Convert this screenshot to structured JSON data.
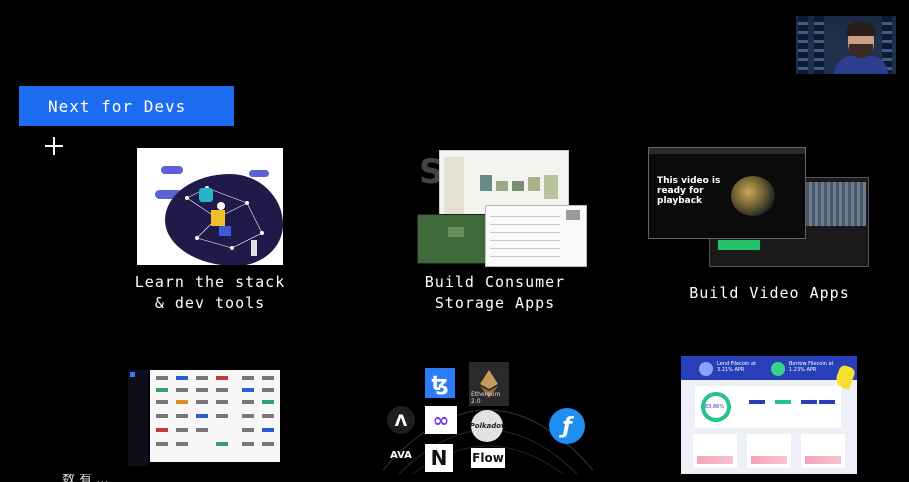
{
  "slide": {
    "title": "Next for Devs"
  },
  "cards": {
    "learn": {
      "caption": "Learn the stack\n& dev tools"
    },
    "storage": {
      "caption": "Build Consumer\nStorage Apps"
    },
    "video": {
      "caption": "Build Video Apps",
      "screen_text": "This video is\nready for\nplayback"
    }
  },
  "chains": {
    "ethereum_label": "Ethereum 2.0",
    "polkadot_label": "Polkadot",
    "flow_label": "Flow",
    "avax_label": "AVA"
  },
  "dashboard": {
    "stat1": "Lend Filecoin at\n3.21% APR",
    "stat2": "Borrow Filecoin at\n1.23% APR",
    "donut_value": "83.86%"
  },
  "subtitle": {
    "text": "数 有 ... ",
    "highlight": ""
  },
  "colors": {
    "accent": "#1c6cf2",
    "background": "#000000",
    "filecoin": "#1e8ff0"
  }
}
